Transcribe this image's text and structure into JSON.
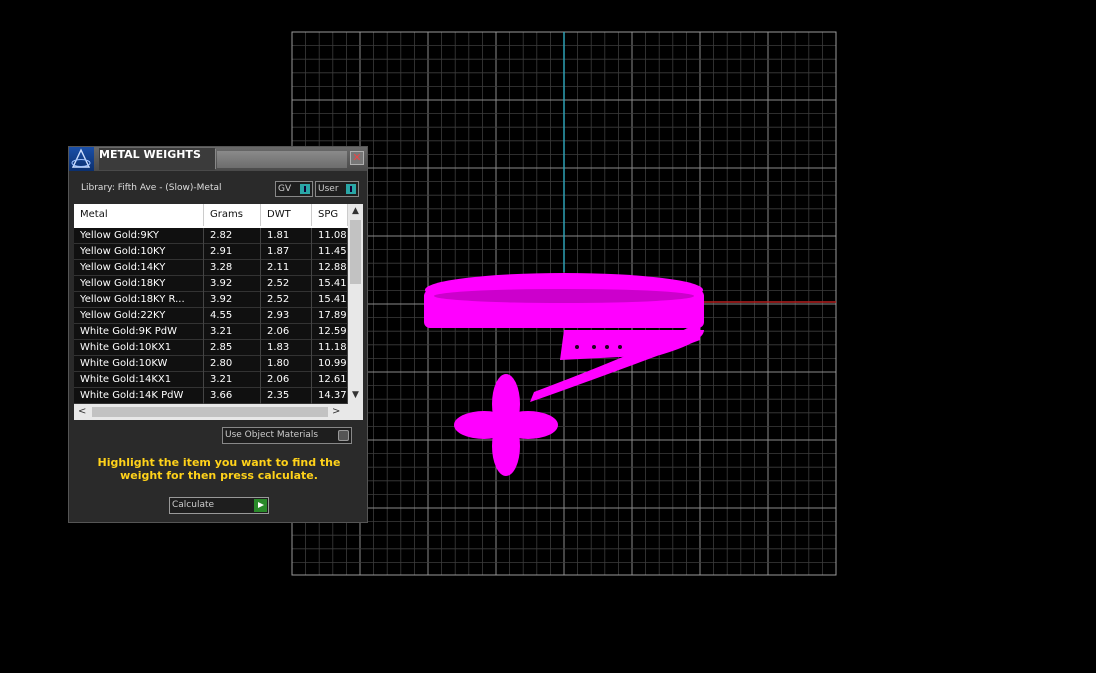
{
  "panel": {
    "title": "METAL WEIGHTS",
    "close_glyph": "✕",
    "library_label": "Library: Fifth Ave - (Slow)-Metal",
    "toggle_gv": "GV",
    "toggle_user": "User",
    "columns": [
      "Metal",
      "Grams",
      "DWT",
      "SPG"
    ],
    "rows": [
      [
        "Yellow Gold:9KY",
        "2.82",
        "1.81",
        "11.08"
      ],
      [
        "Yellow Gold:10KY",
        "2.91",
        "1.87",
        "11.45"
      ],
      [
        "Yellow Gold:14KY",
        "3.28",
        "2.11",
        "12.88"
      ],
      [
        "Yellow Gold:18KY",
        "3.92",
        "2.52",
        "15.41"
      ],
      [
        "Yellow Gold:18KY R...",
        "3.92",
        "2.52",
        "15.41"
      ],
      [
        "Yellow Gold:22KY",
        "4.55",
        "2.93",
        "17.89"
      ],
      [
        "White Gold:9K PdW",
        "3.21",
        "2.06",
        "12.59"
      ],
      [
        "White Gold:10KX1",
        "2.85",
        "1.83",
        "11.18"
      ],
      [
        "White Gold:10KW",
        "2.80",
        "1.80",
        "10.99"
      ],
      [
        "White Gold:14KX1",
        "3.21",
        "2.06",
        "12.61"
      ],
      [
        "White Gold:14K PdW",
        "3.66",
        "2.35",
        "14.37"
      ]
    ],
    "scroll_up": "▲",
    "scroll_down": "▼",
    "scroll_left": "<",
    "scroll_right": ">",
    "use_object_materials": "Use Object Materials",
    "hint": "Highlight the item you want to find the weight for then press calculate.",
    "calculate_label": "Calculate"
  },
  "colors": {
    "grid": "#7a7a7a",
    "y_axis": "#2ea1b5",
    "x_axis": "#b51f1f",
    "model": "#ff00ff",
    "hint": "#ffd21a"
  },
  "icons": {
    "logo": "matrix-logo-icon",
    "close": "close-icon",
    "calculate": "play-icon"
  }
}
